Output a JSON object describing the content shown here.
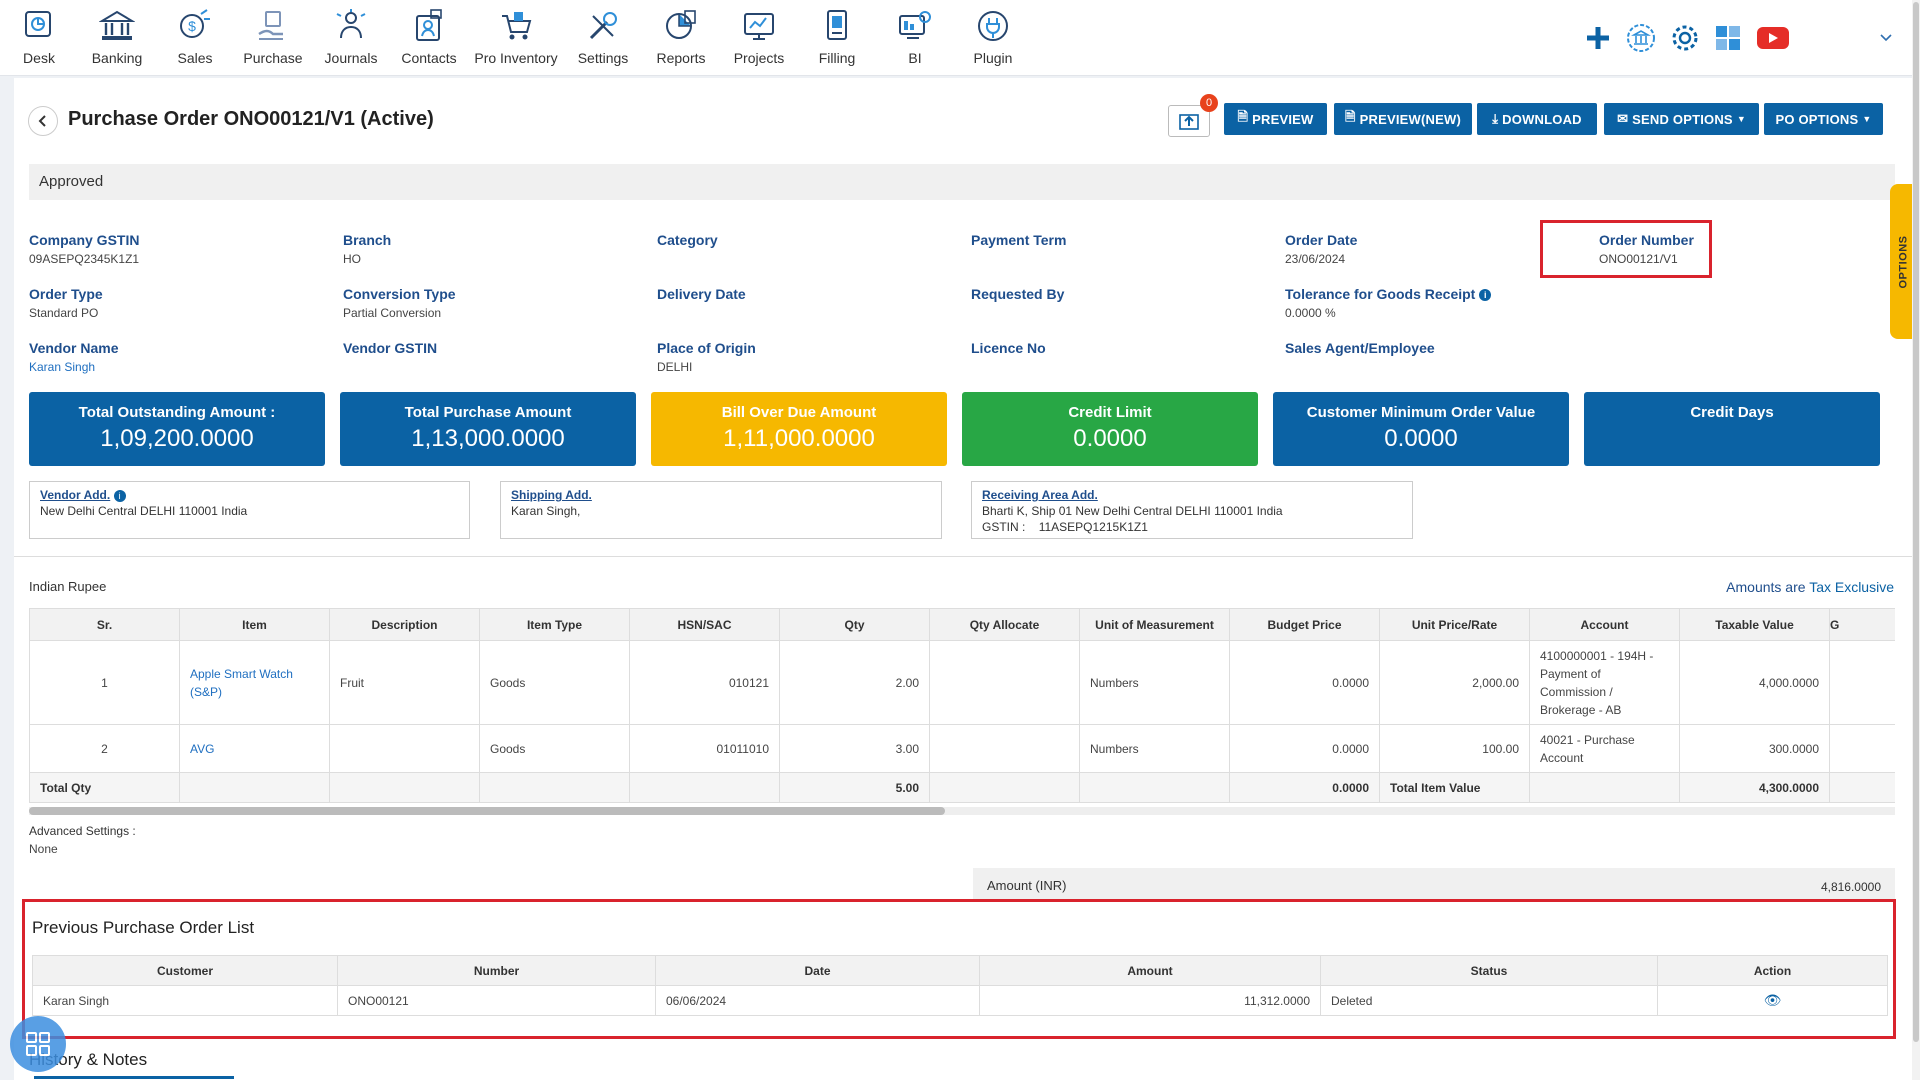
{
  "nav": {
    "items": [
      {
        "label": "Desk",
        "icon": "desk-icon"
      },
      {
        "label": "Banking",
        "icon": "bank-icon"
      },
      {
        "label": "Sales",
        "icon": "sales-icon"
      },
      {
        "label": "Purchase",
        "icon": "purchase-icon"
      },
      {
        "label": "Journals",
        "icon": "journals-icon"
      },
      {
        "label": "Contacts",
        "icon": "contacts-icon"
      },
      {
        "label": "Pro Inventory",
        "icon": "inventory-icon"
      },
      {
        "label": "Settings",
        "icon": "settings-icon"
      },
      {
        "label": "Reports",
        "icon": "reports-icon"
      },
      {
        "label": "Projects",
        "icon": "projects-icon"
      },
      {
        "label": "Filling",
        "icon": "filling-icon"
      },
      {
        "label": "BI",
        "icon": "bi-icon"
      },
      {
        "label": "Plugin",
        "icon": "plugin-icon"
      }
    ],
    "right_icons": [
      "plus-icon",
      "bank-building-icon",
      "gear-icon",
      "apps-icon",
      "youtube-icon",
      "chevron-down-icon"
    ]
  },
  "header": {
    "title": "Purchase Order ONO00121/V1 (Active)",
    "upload_badge": "0",
    "buttons": {
      "preview": "PREVIEW",
      "preview_new": "PREVIEW(NEW)",
      "download": "DOWNLOAD",
      "send_options": "SEND OPTIONS",
      "po_options": "PO OPTIONS"
    }
  },
  "status": "Approved",
  "fields": {
    "company_gstin": {
      "label": "Company GSTIN",
      "value": "09ASEPQ2345K1Z1"
    },
    "branch": {
      "label": "Branch",
      "value": "HO"
    },
    "category": {
      "label": "Category",
      "value": ""
    },
    "payment_term": {
      "label": "Payment Term",
      "value": ""
    },
    "order_date": {
      "label": "Order Date",
      "value": "23/06/2024"
    },
    "order_number": {
      "label": "Order Number",
      "value": "ONO00121/V1"
    },
    "order_type": {
      "label": "Order Type",
      "value": "Standard PO"
    },
    "conversion_type": {
      "label": "Conversion Type",
      "value": "Partial Conversion"
    },
    "delivery_date": {
      "label": "Delivery Date",
      "value": ""
    },
    "requested_by": {
      "label": "Requested By",
      "value": ""
    },
    "tolerance": {
      "label": "Tolerance for Goods Receipt",
      "value": "0.0000 %"
    },
    "vendor_name": {
      "label": "Vendor Name",
      "value": "Karan Singh"
    },
    "vendor_gstin": {
      "label": "Vendor GSTIN",
      "value": ""
    },
    "place_of_origin": {
      "label": "Place of Origin",
      "value": "DELHI"
    },
    "licence_no": {
      "label": "Licence No",
      "value": ""
    },
    "sales_agent": {
      "label": "Sales Agent/Employee",
      "value": ""
    }
  },
  "cards": [
    {
      "title": "Total Outstanding Amount :",
      "value": "1,09,200.0000",
      "color": "#0b62a4"
    },
    {
      "title": "Total Purchase Amount",
      "value": "1,13,000.0000",
      "color": "#0b62a4"
    },
    {
      "title": "Bill Over Due Amount",
      "value": "1,11,000.0000",
      "color": "#f6b800"
    },
    {
      "title": "Credit Limit",
      "value": "0.0000",
      "color": "#28a745"
    },
    {
      "title": "Customer Minimum Order Value",
      "value": "0.0000",
      "color": "#0b62a4"
    },
    {
      "title": "Credit Days",
      "value": "",
      "color": "#0b62a4"
    }
  ],
  "addresses": {
    "vendor": {
      "label": "Vendor Add.",
      "line1": "New Delhi Central DELHI 110001 India"
    },
    "shipping": {
      "label": "Shipping Add.",
      "line1": "Karan Singh,"
    },
    "receiving": {
      "label": "Receiving Area Add.",
      "line1": "Bharti K, Ship 01 New Delhi Central DELHI 110001 India",
      "gstin_label": "GSTIN :",
      "gstin": "11ASEPQ1215K1Z1"
    }
  },
  "items": {
    "currency": "Indian Rupee",
    "tax_note_prefix": "Amounts are",
    "tax_note_value": "Tax Exclusive",
    "columns": [
      "Sr.",
      "Item",
      "Description",
      "Item Type",
      "HSN/SAC",
      "Qty",
      "Qty Allocate",
      "Unit of Measurement",
      "Budget Price",
      "Unit Price/Rate",
      "Account",
      "Taxable Value",
      "G"
    ],
    "rows": [
      {
        "sr": "1",
        "item": "Apple Smart Watch (S&P)",
        "description": "Fruit",
        "item_type": "Goods",
        "hsn": "010121",
        "qty": "2.00",
        "qty_allocate": "",
        "uom": "Numbers",
        "budget_price": "0.0000",
        "unit_price": "2,000.00",
        "account": "4100000001 - 194H - Payment of Commission / Brokerage - AB",
        "taxable_value": "4,000.0000"
      },
      {
        "sr": "2",
        "item": "AVG",
        "description": "",
        "item_type": "Goods",
        "hsn": "01011010",
        "qty": "3.00",
        "qty_allocate": "",
        "uom": "Numbers",
        "budget_price": "0.0000",
        "unit_price": "100.00",
        "account": "40021 - Purchase Account",
        "taxable_value": "300.0000"
      }
    ],
    "total": {
      "label": "Total Qty",
      "qty": "5.00",
      "budget": "0.0000",
      "item_value_label": "Total Item Value",
      "item_value": "4,300.0000"
    }
  },
  "advanced": {
    "label": "Advanced Settings :",
    "value": "None"
  },
  "amount": {
    "label": "Amount (INR)",
    "value": "4,816.0000"
  },
  "previous": {
    "title": "Previous Purchase Order List",
    "columns": [
      "Customer",
      "Number",
      "Date",
      "Amount",
      "Status",
      "Action"
    ],
    "rows": [
      {
        "customer": "Karan Singh",
        "number": "ONO00121",
        "date": "06/06/2024",
        "amount": "11,312.0000",
        "status": "Deleted"
      }
    ]
  },
  "history_title": "History & Notes",
  "options_tab": "OPTIONS"
}
